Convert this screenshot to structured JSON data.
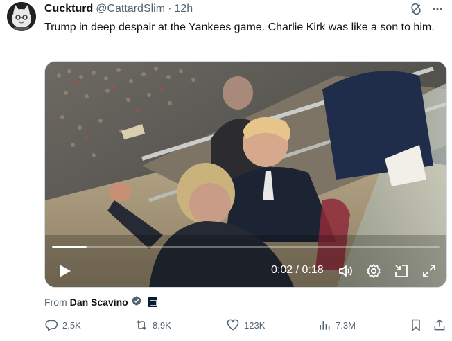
{
  "tweet": {
    "display_name": "Cuckturd",
    "handle": "@CattardSlim",
    "separator": "·",
    "time": "12h",
    "text": "Trump in deep despair at the Yankees game. Charlie Kirk was like a son to him."
  },
  "video": {
    "time_readout": "0:02 / 0:18",
    "progress": 0.09
  },
  "attribution": {
    "prefix": "From",
    "name": "Dan Scavino"
  },
  "actions": {
    "replies": "2.5K",
    "reposts": "8.9K",
    "likes": "123K",
    "views": "7.3M"
  },
  "colors": {
    "text": "#0f1419",
    "muted": "#536471",
    "verified": "#1d9bf0",
    "border": "#cfd9de"
  },
  "icons": [
    "grok-icon",
    "more-icon",
    "play-icon",
    "volume-icon",
    "settings-icon",
    "pip-icon",
    "fullscreen-icon",
    "verified-icon",
    "reply-icon",
    "repost-icon",
    "like-icon",
    "views-icon",
    "bookmark-icon",
    "share-icon"
  ]
}
